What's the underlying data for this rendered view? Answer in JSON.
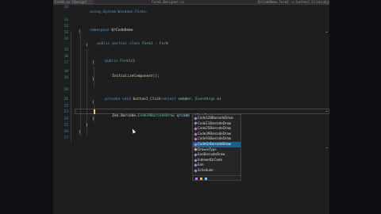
{
  "tabs": [
    {
      "label": "Form1.cs [Design]"
    },
    {
      "label": "Form1.Designer.cs"
    },
    {
      "label": "QrCodeDemo.Form1 -> button1_Click(object sender, EventArgs e)"
    }
  ],
  "line_numbers": [
    "10",
    "11",
    "12",
    "13",
    "14",
    "15",
    "16",
    "17",
    "18",
    "19",
    "20",
    "21",
    "22",
    "23",
    "24",
    "25",
    "26",
    "27"
  ],
  "code": {
    "using": "using System.Windows.Forms;",
    "ns_kw": "namespace",
    "ns_name": "QrCodeDemo",
    "open_brace": "{",
    "close_brace": "}",
    "class_decl_kw": "public partial class",
    "class_name": "Form1",
    "class_base": ": Form",
    "ctor_kw": "public",
    "ctor_name": "Form1",
    "ctor_parens": "()",
    "init_call": "InitializeComponent();",
    "handler_kw": "private void",
    "handler_name": "button1_Click",
    "handler_params_1": "(object",
    "handler_params_2": "sender,",
    "handler_params_3": "EventArgs",
    "handler_params_4": "e)",
    "typing_ns": "Zen.Barcode.",
    "typing_type": "Code39BarcodeDraw",
    "typing_var": "qrcode",
    "typing_rhs": "= Zen.Barcode."
  },
  "intellisense": {
    "items": [
      "Code128BarcodeDraw",
      "Code11BarcodeDraw",
      "Code25BarcodeDraw",
      "Code39BarcodeDraw",
      "Code93BarcodeDraw",
      "CodeQrBarcodeDraw",
      "DrawerType",
      "EanBarcodeDraw",
      "IndexedQrCode",
      "Ean",
      "Scheduler"
    ],
    "selected_index": 5
  },
  "colors": {
    "editor_bg": "#1e1e1e",
    "keyword": "#569cd6",
    "type": "#4ec9b0",
    "selection": "#0e639c"
  }
}
